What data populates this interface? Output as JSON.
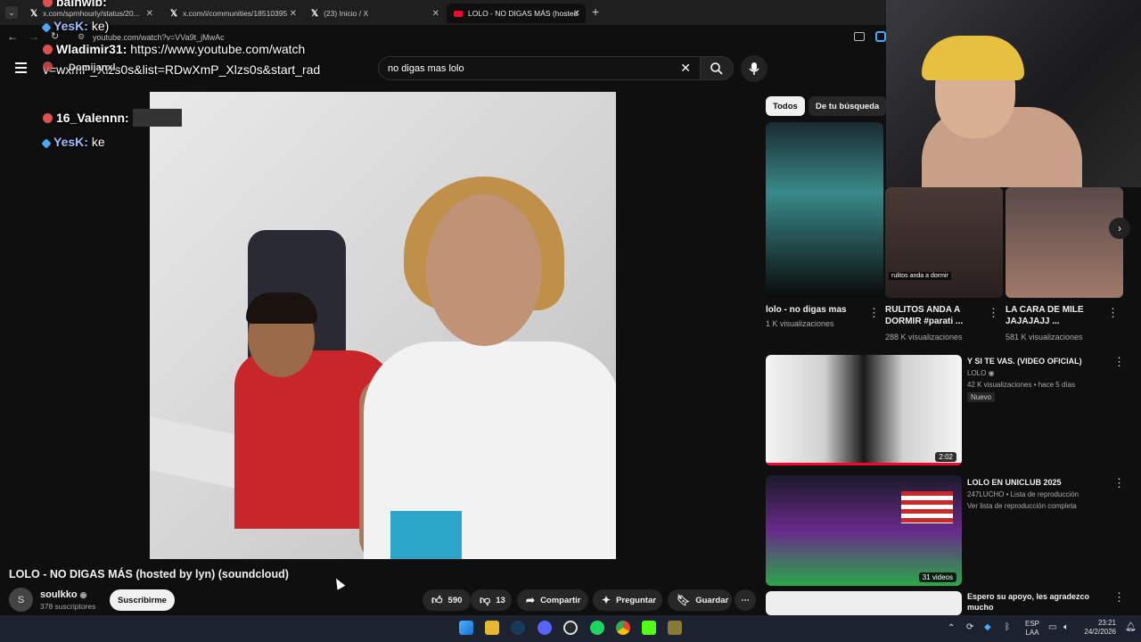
{
  "browser": {
    "tabs": [
      {
        "label": "x.com/sprnhourly/status/20...",
        "icon": "x-logo-icon"
      },
      {
        "label": "x.com/i/communities/18510395",
        "icon": "x-logo-icon"
      },
      {
        "label": "(23) Inicio / X",
        "icon": "x-logo-icon"
      },
      {
        "label": "LOLO - NO DIGAS MÁS (hosted",
        "icon": "youtube-icon"
      }
    ],
    "new_tab": "+",
    "url": "youtube.com/watch?v=VVa9t_jMwAc"
  },
  "youtube": {
    "search_query": "no digas mas lolo",
    "video_title": "LOLO - NO DIGAS MÁS (hosted by lyn) (soundcloud)",
    "channel": {
      "avatar_letter": "S",
      "name": "soulkko",
      "subscribers": "378 suscriptores",
      "subscribe_label": "Suscribirme"
    },
    "actions": {
      "likes": "590",
      "dislikes": "13",
      "share": "Compartir",
      "ask": "Preguntar",
      "save": "Guardar",
      "more": "⋯"
    }
  },
  "chat": [
    {
      "user": "bainwib:",
      "msg": ""
    },
    {
      "user": "YesK:",
      "msg": "ke)"
    },
    {
      "user": "Wladimir31:",
      "msg": "https://www.youtube.com/watch"
    },
    {
      "user": "",
      "msg": "v=wxmP_Xlzs0s&list=RDwXmP_Xlzs0s&start_rad"
    },
    {
      "user": "Domijanxl",
      "msg": ""
    },
    {
      "user": "16_Valennn:",
      "msg": ""
    },
    {
      "user": "YesK:",
      "msg": "ke"
    }
  ],
  "sidebar": {
    "chips": [
      "Todos",
      "De tu búsqueda"
    ],
    "shorts": [
      {
        "title": "lolo - no digas mas",
        "views": "1 K visualizaciones"
      },
      {
        "title": "RULITOS ANDA A DORMIR #parati ...",
        "views": "288 K visualizaciones",
        "caption": "rulitos anda a dormir"
      },
      {
        "title": "LA CARA DE MILE JAJAJAJJ ...",
        "views": "581 K visualizaciones"
      }
    ],
    "videos": [
      {
        "title": "Y SI TE VAS. (VIDEO OFICIAL)",
        "channel": "LOLO",
        "meta": "42 K visualizaciones • hace 5 días",
        "badge": "Nuevo",
        "duration": "2:02"
      },
      {
        "title": "LOLO EN UNICLUB 2025",
        "channel": "247LUCHO • Lista de reproducción",
        "meta": "Ver lista de reproducción completa",
        "duration": "31 videos"
      },
      {
        "title": "Espero su apoyo, les agradezco mucho",
        "channel": "",
        "meta": ""
      }
    ]
  },
  "taskbar": {
    "lang1": "ESP",
    "lang2": "LAA",
    "time": "23:21",
    "date": "24/2/2026"
  },
  "colors": {
    "accent": "#ff0033",
    "bg": "#0f0f0f",
    "chip_active": "#f1f1f1"
  }
}
